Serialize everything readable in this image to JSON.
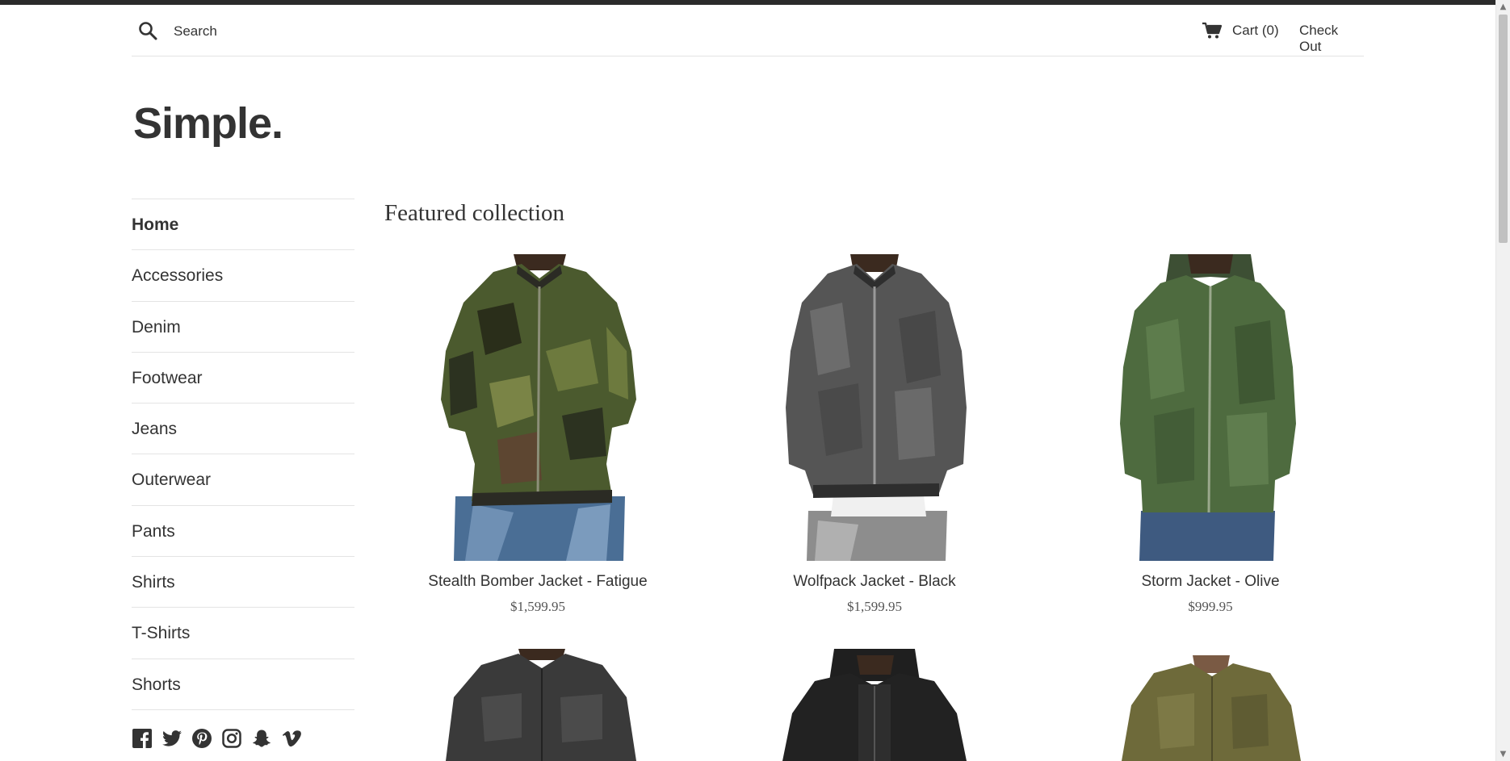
{
  "header": {
    "search_placeholder": "Search",
    "cart_label": "Cart (0)",
    "checkout_label": "Check Out"
  },
  "logo": "Simple.",
  "sidebar": {
    "items": [
      {
        "label": "Home",
        "active": true
      },
      {
        "label": "Accessories"
      },
      {
        "label": "Denim"
      },
      {
        "label": "Footwear"
      },
      {
        "label": "Jeans"
      },
      {
        "label": "Outerwear"
      },
      {
        "label": "Pants"
      },
      {
        "label": "Shirts"
      },
      {
        "label": "T-Shirts"
      },
      {
        "label": "Shorts"
      }
    ],
    "social_icons": [
      "facebook-icon",
      "twitter-icon",
      "pinterest-icon",
      "instagram-icon",
      "snapchat-icon",
      "vimeo-icon"
    ]
  },
  "main": {
    "title": "Featured collection",
    "products": [
      {
        "title": "Stealth Bomber Jacket - Fatigue",
        "price": "$1,599.95"
      },
      {
        "title": "Wolfpack Jacket - Black",
        "price": "$1,599.95"
      },
      {
        "title": "Storm Jacket - Olive",
        "price": "$999.95"
      },
      {
        "title": "",
        "price": ""
      },
      {
        "title": "",
        "price": ""
      },
      {
        "title": "",
        "price": ""
      }
    ]
  },
  "colors": {
    "text": "#333333",
    "border": "#e4e4e4",
    "top_strip": "#2b2b2b"
  }
}
